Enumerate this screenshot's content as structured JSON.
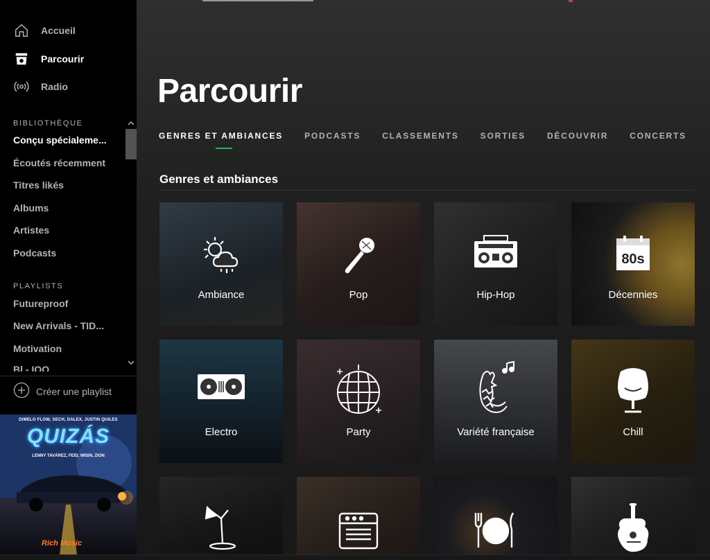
{
  "sidebar": {
    "nav": [
      {
        "label": "Accueil",
        "icon": "home-icon"
      },
      {
        "label": "Parcourir",
        "icon": "browse-icon"
      },
      {
        "label": "Radio",
        "icon": "radio-icon"
      }
    ],
    "library_title": "BIBLIOTHÈQUE",
    "library": [
      "Conçu spécialeme...",
      "Écoutés récemment",
      "Titres likés",
      "Albums",
      "Artistes",
      "Podcasts"
    ],
    "playlists_title": "PLAYLISTS",
    "playlists": [
      "Futureproof",
      "New Arrivals - TID...",
      "Motivation",
      "Bl    -  IOO"
    ],
    "create_playlist": "Créer une playlist",
    "album_art": {
      "artists": "DIMELO FLOW, SECH, DALEX, JUSTIN QUILES",
      "title": "QUIZÁS",
      "featuring": "LENNY TAVÁREZ, FEID, WISIN, ZION",
      "logo": "Rich Music"
    }
  },
  "main": {
    "title": "Parcourir",
    "tabs": [
      "GENRES ET AMBIANCES",
      "PODCASTS",
      "CLASSEMENTS",
      "SORTIES",
      "DÉCOUVRIR",
      "CONCERTS"
    ],
    "active_tab": 0,
    "section_heading": "Genres et ambiances",
    "tiles": [
      {
        "label": "Ambiance",
        "icon": "weather-icon",
        "color": "#3a4a5a"
      },
      {
        "label": "Pop",
        "icon": "microphone-icon",
        "color": "#5a4a48"
      },
      {
        "label": "Hip-Hop",
        "icon": "boombox-icon",
        "color": "#3f3f3f"
      },
      {
        "label": "Décennies",
        "icon": "calendar-80s-icon",
        "color": "#8a6a3a"
      },
      {
        "label": "Electro",
        "icon": "turntables-icon",
        "color": "#2c4a5c"
      },
      {
        "label": "Party",
        "icon": "disco-ball-icon",
        "color": "#4a3a3e"
      },
      {
        "label": "Variété française",
        "icon": "rooster-icon",
        "color": "#4a4a50"
      },
      {
        "label": "Chill",
        "icon": "egg-chair-icon",
        "color": "#5a4a2a"
      },
      {
        "label": "",
        "icon": "lamp-icon",
        "color": "#2a2a2a"
      },
      {
        "label": "",
        "icon": "amplifier-icon",
        "color": "#4a3c34"
      },
      {
        "label": "",
        "icon": "dinner-icon",
        "color": "#2e3038"
      },
      {
        "label": "",
        "icon": "guitar-icon",
        "color": "#353535"
      }
    ],
    "tab80s": "80s"
  },
  "colors": {
    "accent": "#1db954",
    "sidebar_bg": "#000000",
    "main_bg": "#181818"
  }
}
